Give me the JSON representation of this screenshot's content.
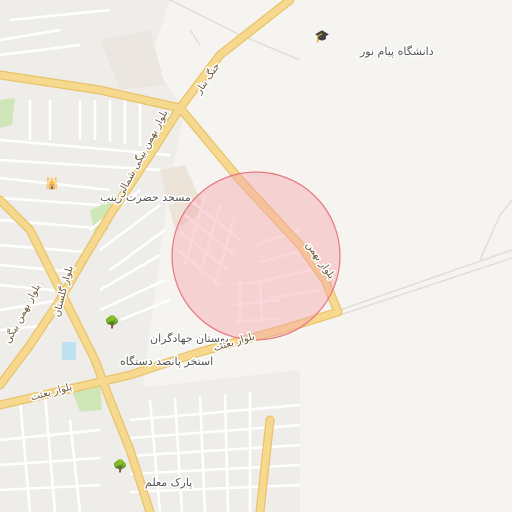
{
  "map": {
    "colors": {
      "background": "#f6f4f1",
      "urban": "#efedea",
      "street": "#ffffff",
      "arterial": "#f6d98f",
      "arterial_casing": "#e8c36a",
      "park": "#cfe6b8",
      "water": "#bfe0ef",
      "highlight_fill": "#f4a6ad",
      "highlight_stroke": "#e8777f"
    },
    "labels": {
      "university": "دانشگاه پیام نور",
      "mosque": "مسجد حضرت زینب",
      "park_jahadgaran": "بوستان جهادگران",
      "pool": "استخر پانصد دستگاه",
      "park_moalem": "پارک معلم",
      "road_besat_center": "بلوار بعثت",
      "road_besat_west": "بلوار بعثت",
      "road_beheshti": "بلوار بهمن",
      "road_shomali": "بلوار بهمن بیگی شمالی",
      "road_ghestan": "بلوار گلستان",
      "road_bahman_west": "بلوار بهمن بیگی",
      "road_jang": "جنگ بنار"
    },
    "icons": {
      "university": "graduation-cap-icon",
      "mosque": "mosque-icon",
      "park": "tree-icon"
    }
  }
}
